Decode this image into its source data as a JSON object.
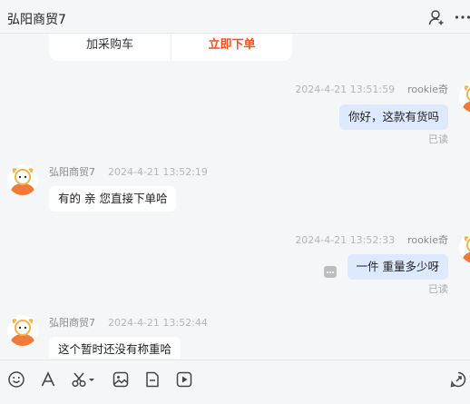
{
  "header": {
    "title": "弘阳商贸7",
    "icons": [
      "user-add-icon",
      "more-icon"
    ]
  },
  "previous_card": {
    "add_to_cart_label": "加采购车",
    "order_now_label": "立即下单",
    "accent_color": "#f0501e"
  },
  "messages": [
    {
      "side": "right",
      "sender": "rookie奇",
      "time": "2024-4-21 13:51:59",
      "text": "你好，这款有货吗",
      "status": "已读"
    },
    {
      "side": "left",
      "sender": "弘阳商贸7",
      "time": "2024-4-21 13:52:19",
      "text": "有的 亲  您直接下单哈"
    },
    {
      "side": "right",
      "sender": "rookie奇",
      "time": "2024-4-21 13:52:33",
      "text": "一件 重量多少呀",
      "status": "已读"
    },
    {
      "side": "left",
      "sender": "弘阳商贸7",
      "time": "2024-4-21 13:52:44",
      "text": "这个暂时还没有称重哈"
    }
  ],
  "toolbar": {
    "icons": [
      "emoji-icon",
      "font-icon",
      "scissors-icon",
      "image-icon",
      "file-icon",
      "video-icon",
      "quick-reply-icon"
    ]
  },
  "colors": {
    "background": "#f5f6f8",
    "own_bubble": "#dde9ff",
    "other_bubble": "#ffffff"
  }
}
